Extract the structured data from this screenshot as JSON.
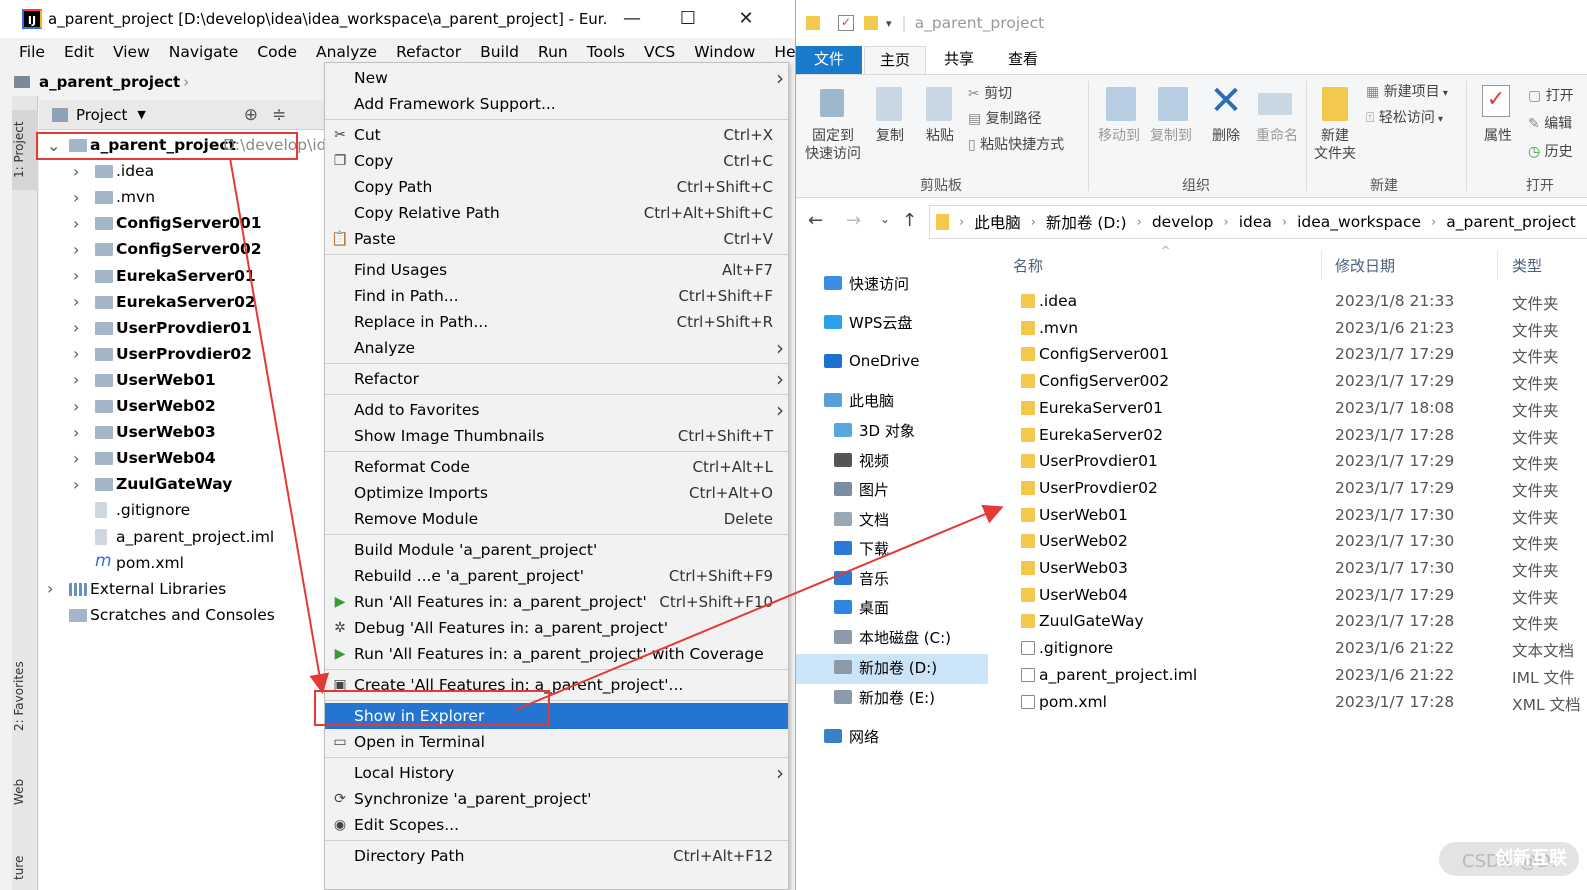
{
  "idea": {
    "title": "a_parent_project [D:\\develop\\idea\\idea_workspace\\a_parent_project] - Eur...",
    "menu": [
      "File",
      "Edit",
      "View",
      "Navigate",
      "Code",
      "Analyze",
      "Refactor",
      "Build",
      "Run",
      "Tools",
      "VCS",
      "Window",
      "Help"
    ],
    "breadcrumb": "a_parent_project",
    "panel_title": "Project",
    "left_tabs": [
      "1: Project",
      "2: Favorites",
      "Web",
      "ture"
    ],
    "tree": [
      {
        "label": "a_parent_project",
        "suffix": "D:\\develop\\ide",
        "bold": true,
        "depth": 0,
        "expanded": true
      },
      {
        "label": ".idea",
        "bold": false,
        "depth": 1
      },
      {
        "label": ".mvn",
        "bold": false,
        "depth": 1
      },
      {
        "label": "ConfigServer001",
        "bold": true,
        "depth": 1
      },
      {
        "label": "ConfigServer002",
        "bold": true,
        "depth": 1
      },
      {
        "label": "EurekaServer01",
        "bold": true,
        "depth": 1
      },
      {
        "label": "EurekaServer02",
        "bold": true,
        "depth": 1
      },
      {
        "label": "UserProvdier01",
        "bold": true,
        "depth": 1
      },
      {
        "label": "UserProvdier02",
        "bold": true,
        "depth": 1
      },
      {
        "label": "UserWeb01",
        "bold": true,
        "depth": 1
      },
      {
        "label": "UserWeb02",
        "bold": true,
        "depth": 1
      },
      {
        "label": "UserWeb03",
        "bold": true,
        "depth": 1
      },
      {
        "label": "UserWeb04",
        "bold": true,
        "depth": 1
      },
      {
        "label": "ZuulGateWay",
        "bold": true,
        "depth": 1
      },
      {
        "label": ".gitignore",
        "bold": false,
        "depth": 1,
        "file": true
      },
      {
        "label": "a_parent_project.iml",
        "bold": false,
        "depth": 1,
        "file": true
      },
      {
        "label": "pom.xml",
        "bold": false,
        "depth": 1,
        "file": true
      },
      {
        "label": "External Libraries",
        "bold": false,
        "depth": 0
      },
      {
        "label": "Scratches and Consoles",
        "bold": false,
        "depth": 0
      }
    ]
  },
  "context_menu": [
    {
      "label": "New",
      "shortcut": "",
      "submenu": true
    },
    {
      "label": "Add Framework Support...",
      "shortcut": ""
    },
    {
      "sep": true
    },
    {
      "label": "Cut",
      "shortcut": "Ctrl+X",
      "icon": "✂"
    },
    {
      "label": "Copy",
      "shortcut": "Ctrl+C",
      "icon": "❐"
    },
    {
      "label": "Copy Path",
      "shortcut": "Ctrl+Shift+C"
    },
    {
      "label": "Copy Relative Path",
      "shortcut": "Ctrl+Alt+Shift+C"
    },
    {
      "label": "Paste",
      "shortcut": "Ctrl+V",
      "icon": "📋"
    },
    {
      "sep": true
    },
    {
      "label": "Find Usages",
      "shortcut": "Alt+F7"
    },
    {
      "label": "Find in Path...",
      "shortcut": "Ctrl+Shift+F"
    },
    {
      "label": "Replace in Path...",
      "shortcut": "Ctrl+Shift+R"
    },
    {
      "label": "Analyze",
      "shortcut": "",
      "submenu": true
    },
    {
      "sep": true
    },
    {
      "label": "Refactor",
      "shortcut": "",
      "submenu": true
    },
    {
      "sep": true
    },
    {
      "label": "Add to Favorites",
      "shortcut": "",
      "submenu": true
    },
    {
      "label": "Show Image Thumbnails",
      "shortcut": "Ctrl+Shift+T"
    },
    {
      "sep": true
    },
    {
      "label": "Reformat Code",
      "shortcut": "Ctrl+Alt+L"
    },
    {
      "label": "Optimize Imports",
      "shortcut": "Ctrl+Alt+O"
    },
    {
      "label": "Remove Module",
      "shortcut": "Delete"
    },
    {
      "sep": true
    },
    {
      "label": "Build Module 'a_parent_project'",
      "shortcut": ""
    },
    {
      "label": "Rebuild ...e 'a_parent_project'",
      "shortcut": "Ctrl+Shift+F9"
    },
    {
      "label": "Run 'All Features in: a_parent_project'",
      "shortcut": "Ctrl+Shift+F10",
      "icon": "▶"
    },
    {
      "label": "Debug 'All Features in: a_parent_project'",
      "shortcut": "",
      "icon": "✲"
    },
    {
      "label": "Run 'All Features in: a_parent_project' with Coverage",
      "shortcut": "",
      "icon": "▶"
    },
    {
      "sep": true
    },
    {
      "label": "Create 'All Features in: a_parent_project'...",
      "shortcut": "",
      "icon": "▣"
    },
    {
      "sep": true
    },
    {
      "label": "Show in Explorer",
      "shortcut": "",
      "highlight": true
    },
    {
      "label": "Open in Terminal",
      "shortcut": "",
      "icon": "▭"
    },
    {
      "sep": true
    },
    {
      "label": "Local History",
      "shortcut": "",
      "submenu": true
    },
    {
      "label": "Synchronize 'a_parent_project'",
      "shortcut": "",
      "icon": "⟳"
    },
    {
      "label": "Edit Scopes...",
      "shortcut": "",
      "icon": "◉"
    },
    {
      "sep": true
    },
    {
      "label": "Directory Path",
      "shortcut": "Ctrl+Alt+F12"
    }
  ],
  "explorer": {
    "title": "a_parent_project",
    "tabs": [
      "文件",
      "主页",
      "共享",
      "查看"
    ],
    "ribbon": {
      "pin": "固定到\n快速访问",
      "copy": "复制",
      "paste": "粘贴",
      "cut": "剪切",
      "copy_path": "复制路径",
      "paste_shortcut": "粘贴快捷方式",
      "move_to": "移动到",
      "copy_to": "复制到",
      "delete": "删除",
      "rename": "重命名",
      "new_folder": "新建\n文件夹",
      "new_item": "新建项目",
      "easy_access": "轻松访问",
      "properties": "属性",
      "open": "打开",
      "edit": "编辑",
      "history": "历史",
      "group_clipboard": "剪贴板",
      "group_organize": "组织",
      "group_new": "新建",
      "group_open": "打开"
    },
    "address": [
      "此电脑",
      "新加卷 (D:)",
      "develop",
      "idea",
      "idea_workspace",
      "a_parent_project"
    ],
    "nav": [
      {
        "label": "快速访问",
        "color": "#3b8ee6"
      },
      {
        "label": "WPS云盘",
        "color": "#2aa1e8"
      },
      {
        "label": "OneDrive",
        "color": "#1d6fd1"
      },
      {
        "label": "此电脑",
        "color": "#5a9fd8"
      },
      {
        "label": "3D 对象",
        "color": "#55a8e0"
      },
      {
        "label": "视频",
        "color": "#555555"
      },
      {
        "label": "图片",
        "color": "#7a8ea3"
      },
      {
        "label": "文档",
        "color": "#9aa7b4"
      },
      {
        "label": "下载",
        "color": "#2b7bd6"
      },
      {
        "label": "音乐",
        "color": "#2b7bd6"
      },
      {
        "label": "桌面",
        "color": "#2e86de"
      },
      {
        "label": "本地磁盘 (C:)",
        "color": "#8a9aa8"
      },
      {
        "label": "新加卷 (D:)",
        "color": "#8a9aa8"
      },
      {
        "label": "新加卷 (E:)",
        "color": "#8a9aa8"
      },
      {
        "label": "网络",
        "color": "#3a7fc8"
      }
    ],
    "columns": [
      "名称",
      "修改日期",
      "类型"
    ],
    "files": [
      {
        "name": ".idea",
        "date": "2023/1/8 21:33",
        "type": "文件夹"
      },
      {
        "name": ".mvn",
        "date": "2023/1/6 21:23",
        "type": "文件夹"
      },
      {
        "name": "ConfigServer001",
        "date": "2023/1/7 17:29",
        "type": "文件夹"
      },
      {
        "name": "ConfigServer002",
        "date": "2023/1/7 17:29",
        "type": "文件夹"
      },
      {
        "name": "EurekaServer01",
        "date": "2023/1/7 18:08",
        "type": "文件夹"
      },
      {
        "name": "EurekaServer02",
        "date": "2023/1/7 17:28",
        "type": "文件夹"
      },
      {
        "name": "UserProvdier01",
        "date": "2023/1/7 17:29",
        "type": "文件夹"
      },
      {
        "name": "UserProvdier02",
        "date": "2023/1/7 17:29",
        "type": "文件夹"
      },
      {
        "name": "UserWeb01",
        "date": "2023/1/7 17:30",
        "type": "文件夹"
      },
      {
        "name": "UserWeb02",
        "date": "2023/1/7 17:30",
        "type": "文件夹"
      },
      {
        "name": "UserWeb03",
        "date": "2023/1/7 17:30",
        "type": "文件夹"
      },
      {
        "name": "UserWeb04",
        "date": "2023/1/7 17:29",
        "type": "文件夹"
      },
      {
        "name": "ZuulGateWay",
        "date": "2023/1/7 17:28",
        "type": "文件夹"
      },
      {
        "name": ".gitignore",
        "date": "2023/1/6 21:22",
        "type": "文本文档",
        "doc": true
      },
      {
        "name": "a_parent_project.iml",
        "date": "2023/1/6 21:22",
        "type": "IML 文件",
        "doc": true
      },
      {
        "name": "pom.xml",
        "date": "2023/1/7 17:28",
        "type": "XML 文档",
        "doc": true
      }
    ]
  },
  "watermark": "CSDN @D:",
  "watermark2": "创新互联",
  "colors": {
    "highlight": "#2475d1",
    "annotation": "#e53935",
    "explorer_tab": "#1979ca"
  }
}
